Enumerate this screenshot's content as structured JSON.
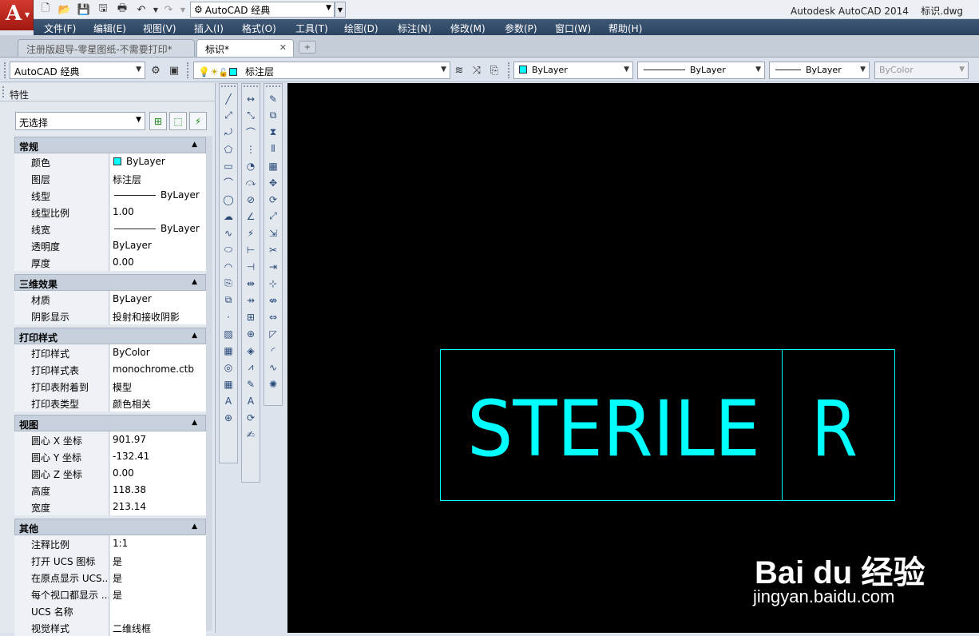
{
  "app": {
    "title": "Autodesk AutoCAD 2014",
    "filename": "标识.dwg",
    "workspace": "AutoCAD 经典"
  },
  "menu": [
    "文件(F)",
    "编辑(E)",
    "视图(V)",
    "插入(I)",
    "格式(O)",
    "工具(T)",
    "绘图(D)",
    "标注(N)",
    "修改(M)",
    "参数(P)",
    "窗口(W)",
    "帮助(H)"
  ],
  "tabs": [
    {
      "label": "注册版超导-零星图纸-不需要打印*",
      "active": false
    },
    {
      "label": "标识*",
      "active": true
    }
  ],
  "toolbar2": {
    "workspace": "AutoCAD 经典",
    "layer": "标注层",
    "color": "ByLayer",
    "linetype": "ByLayer",
    "lineweight": "ByLayer",
    "plotstyle": "ByColor"
  },
  "properties": {
    "title": "特性",
    "selection": "无选择",
    "sections": [
      {
        "name": "常规",
        "rows": [
          {
            "label": "颜色",
            "value": "ByLayer",
            "swatch": "#00ffff"
          },
          {
            "label": "图层",
            "value": "标注层"
          },
          {
            "label": "线型",
            "value": "ByLayer",
            "line": true
          },
          {
            "label": "线型比例",
            "value": "1.00"
          },
          {
            "label": "线宽",
            "value": "ByLayer",
            "line": true
          },
          {
            "label": "透明度",
            "value": "ByLayer"
          },
          {
            "label": "厚度",
            "value": "0.00"
          }
        ]
      },
      {
        "name": "三维效果",
        "rows": [
          {
            "label": "材质",
            "value": "ByLayer"
          },
          {
            "label": "阴影显示",
            "value": "投射和接收阴影"
          }
        ]
      },
      {
        "name": "打印样式",
        "rows": [
          {
            "label": "打印样式",
            "value": "ByColor"
          },
          {
            "label": "打印样式表",
            "value": "monochrome.ctb"
          },
          {
            "label": "打印表附着到",
            "value": "模型"
          },
          {
            "label": "打印表类型",
            "value": "颜色相关"
          }
        ]
      },
      {
        "name": "视图",
        "rows": [
          {
            "label": "圆心 X 坐标",
            "value": "901.97"
          },
          {
            "label": "圆心 Y 坐标",
            "value": "-132.41"
          },
          {
            "label": "圆心 Z 坐标",
            "value": "0.00"
          },
          {
            "label": "高度",
            "value": "118.38"
          },
          {
            "label": "宽度",
            "value": "213.14"
          }
        ]
      },
      {
        "name": "其他",
        "rows": [
          {
            "label": "注释比例",
            "value": "1:1"
          },
          {
            "label": "打开 UCS 图标",
            "value": "是"
          },
          {
            "label": "在原点显示 UCS...",
            "value": "是"
          },
          {
            "label": "每个视口都显示 ...",
            "value": "是"
          },
          {
            "label": "UCS 名称",
            "value": ""
          },
          {
            "label": "视觉样式",
            "value": "二维线框"
          }
        ]
      }
    ]
  },
  "drawing": {
    "text_left": "STERILE",
    "text_right": "R",
    "color": "#00ffff",
    "background": "#000000"
  },
  "watermark": {
    "logo": "Bai du 经验",
    "url": "jingyan.baidu.com"
  }
}
